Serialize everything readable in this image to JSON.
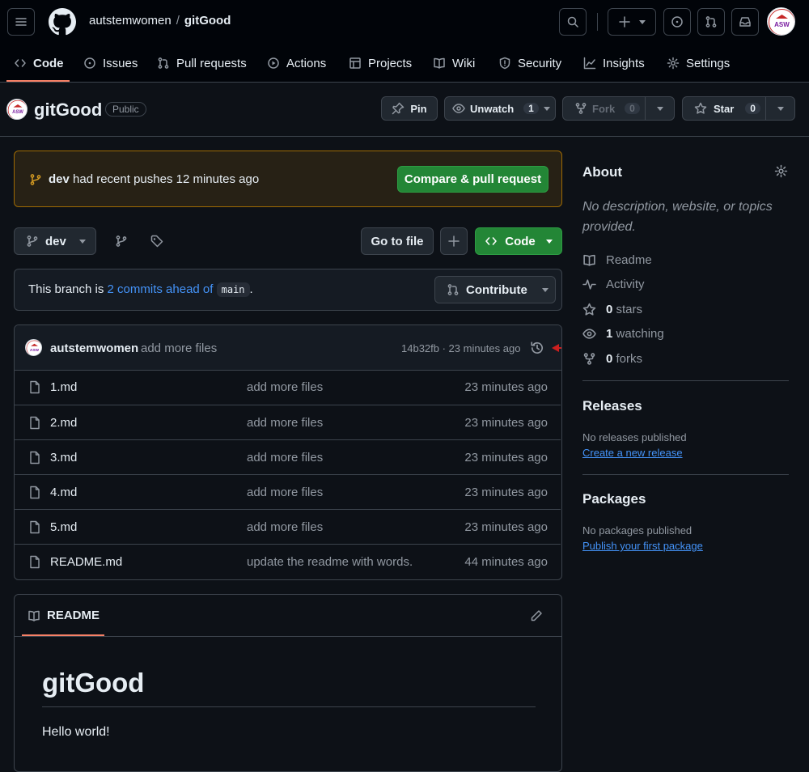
{
  "header": {
    "owner": "autstemwomen",
    "separator": "/",
    "repo": "gitGood",
    "avatar_text": "ASW"
  },
  "nav": {
    "tabs": [
      {
        "label": "Code",
        "icon": "code-icon"
      },
      {
        "label": "Issues",
        "icon": "issue-icon"
      },
      {
        "label": "Pull requests",
        "icon": "pull-request-icon"
      },
      {
        "label": "Actions",
        "icon": "play-icon"
      },
      {
        "label": "Projects",
        "icon": "table-icon"
      },
      {
        "label": "Wiki",
        "icon": "book-icon"
      },
      {
        "label": "Security",
        "icon": "shield-icon"
      },
      {
        "label": "Insights",
        "icon": "graph-icon"
      },
      {
        "label": "Settings",
        "icon": "gear-icon"
      }
    ]
  },
  "repo_bar": {
    "title": "gitGood",
    "visibility": "Public",
    "pin_label": "Pin",
    "watch_label": "Unwatch",
    "watch_count": "1",
    "fork_label": "Fork",
    "fork_count": "0",
    "star_label": "Star",
    "star_count": "0"
  },
  "banner": {
    "branch": "dev",
    "text": " had recent pushes 12 minutes ago",
    "button": "Compare & pull request"
  },
  "branch_row": {
    "branch": "dev",
    "go_to_file": "Go to file",
    "code_label": "Code"
  },
  "ahead": {
    "prefix": "This branch is ",
    "link": "2 commits ahead of",
    "base": "main",
    "suffix": ".",
    "contribute": "Contribute"
  },
  "latest_commit": {
    "author": "autstemwomen",
    "message": "add more files",
    "meta": "14b32fb · 23 minutes ago"
  },
  "files": [
    {
      "name": "1.md",
      "message": "add more files",
      "time": "23 minutes ago"
    },
    {
      "name": "2.md",
      "message": "add more files",
      "time": "23 minutes ago"
    },
    {
      "name": "3.md",
      "message": "add more files",
      "time": "23 minutes ago"
    },
    {
      "name": "4.md",
      "message": "add more files",
      "time": "23 minutes ago"
    },
    {
      "name": "5.md",
      "message": "add more files",
      "time": "23 minutes ago"
    },
    {
      "name": "README.md",
      "message": "update the readme with words.",
      "time": "44 minutes ago"
    }
  ],
  "readme": {
    "tab": "README",
    "heading": "gitGood",
    "body": "Hello world!"
  },
  "sidebar": {
    "about_title": "About",
    "description": "No description, website, or topics provided.",
    "readme": "Readme",
    "activity": "Activity",
    "stars_count": "0",
    "stars_label": "stars",
    "watching_count": "1",
    "watching_label": "watching",
    "forks_count": "0",
    "forks_label": "forks",
    "releases_title": "Releases",
    "releases_none": "No releases published",
    "releases_link": "Create a new release",
    "packages_title": "Packages",
    "packages_none": "No packages published",
    "packages_link": "Publish your first package"
  },
  "colors": {
    "background": "#0d1117",
    "accent_green": "#238636",
    "link_blue": "#4493f8",
    "tab_underline": "#f78166",
    "annotation_arrow": "#cc1f1f"
  }
}
